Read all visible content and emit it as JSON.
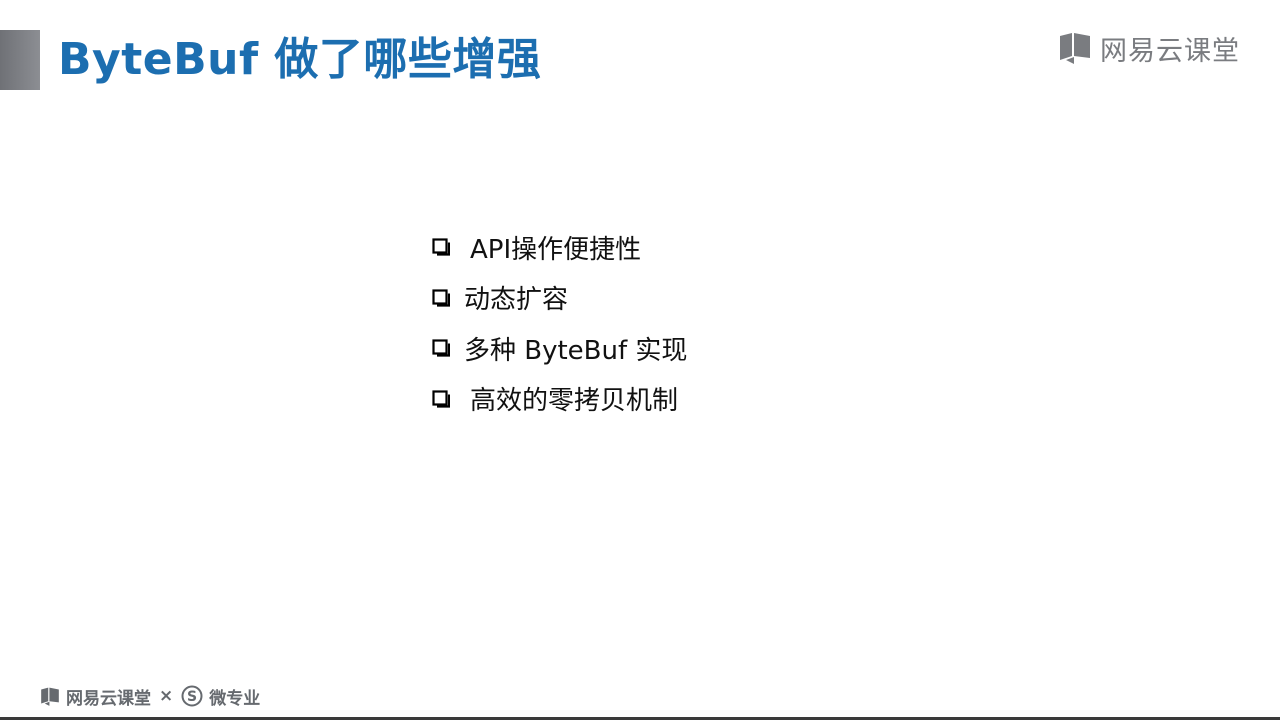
{
  "slide": {
    "title": "ByteBuf 做了哪些增强"
  },
  "logo": {
    "text": "网易云课堂",
    "icon": "book-icon"
  },
  "bullets": [
    {
      "text": "API操作便捷性",
      "icon": "checkbox-icon"
    },
    {
      "text": "动态扩容",
      "icon": "checkbox-icon"
    },
    {
      "text": "多种 ByteBuf 实现",
      "icon": "checkbox-icon"
    },
    {
      "text": "高效的零拷贝机制",
      "icon": "checkbox-icon"
    }
  ],
  "footer": {
    "brand": "网易云课堂",
    "separator": "×",
    "partner": "微专业",
    "partner_icon": "s-circle-icon"
  },
  "colors": {
    "title": "#1c6eb0",
    "accent_bar": "#7a7c80",
    "logo": "#7a7c80",
    "text": "#111111"
  }
}
